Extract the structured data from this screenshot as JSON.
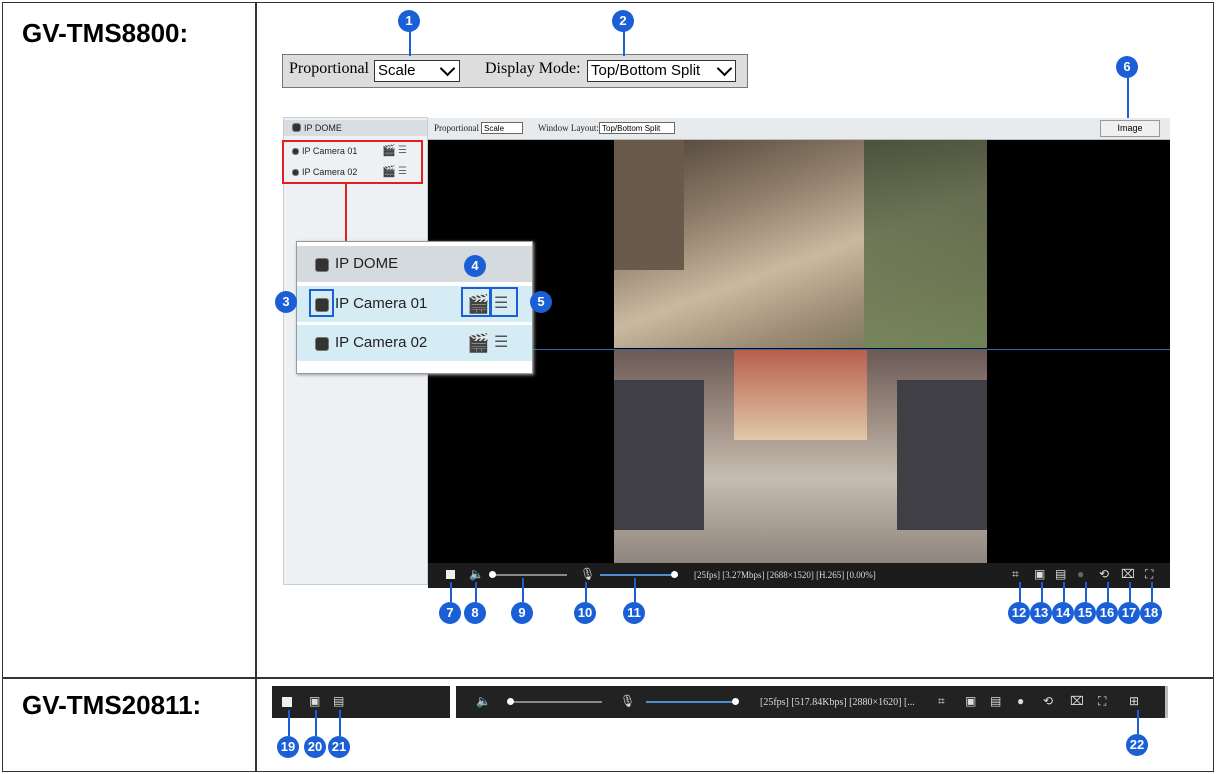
{
  "models": {
    "top": "GV-TMS8800:",
    "bottom": "GV-TMS20811:"
  },
  "controls": {
    "proportional_label": "Proportional",
    "proportional_value": "Scale",
    "display_mode_label": "Display Mode:",
    "display_mode_value": "Top/Bottom Split"
  },
  "screenshot": {
    "tree_root": "IP DOME",
    "cameras": [
      "IP Camera 01",
      "IP Camera 02"
    ],
    "toolbar": {
      "proportional_label": "Proportional",
      "proportional_value": "Scale",
      "window_layout_label": "Window Layout:",
      "window_layout_value": "Top/Bottom Split",
      "image_button": "Image"
    },
    "status_text": "[25fps] [3.27Mbps] [2688×1520] [H.265] [0.00%]"
  },
  "zoom_panel": {
    "root": "IP DOME",
    "cameras": [
      "IP Camera 01",
      "IP Camera 02"
    ]
  },
  "bottom_bar": {
    "status_text": "[25fps] [517.84Kbps] [2880×1620] [..."
  },
  "callouts": [
    "1",
    "2",
    "3",
    "4",
    "5",
    "6",
    "7",
    "8",
    "9",
    "10",
    "11",
    "12",
    "13",
    "14",
    "15",
    "16",
    "17",
    "18",
    "19",
    "20",
    "21",
    "22"
  ],
  "colors": {
    "callout": "#1a5fd6",
    "highlight_red": "#e02020",
    "toolbar_dark": "#1c1c1c"
  }
}
